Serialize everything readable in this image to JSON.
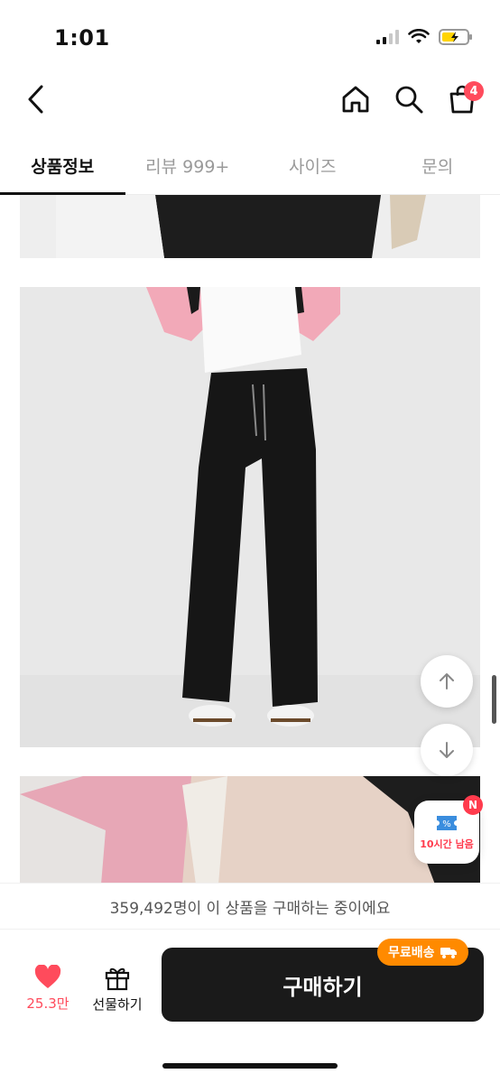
{
  "status": {
    "time": "1:01"
  },
  "header": {
    "cart_count": "4"
  },
  "tabs": [
    {
      "label": "상품정보"
    },
    {
      "label": "리뷰 999+"
    },
    {
      "label": "사이즈"
    },
    {
      "label": "문의"
    }
  ],
  "coupon": {
    "badge": "N",
    "label": "10시간 남음"
  },
  "banner": {
    "text": "359,492명이 이 상품을 구매하는 중이에요"
  },
  "bottom": {
    "like_count": "25.3만",
    "gift_label": "선물하기",
    "buy_label": "구매하기",
    "free_shipping": "무료배송"
  },
  "colors": {
    "accent_red": "#ff4b5c",
    "free_ship_orange": "#ff8a00",
    "buy_button": "#1a1a1a"
  }
}
